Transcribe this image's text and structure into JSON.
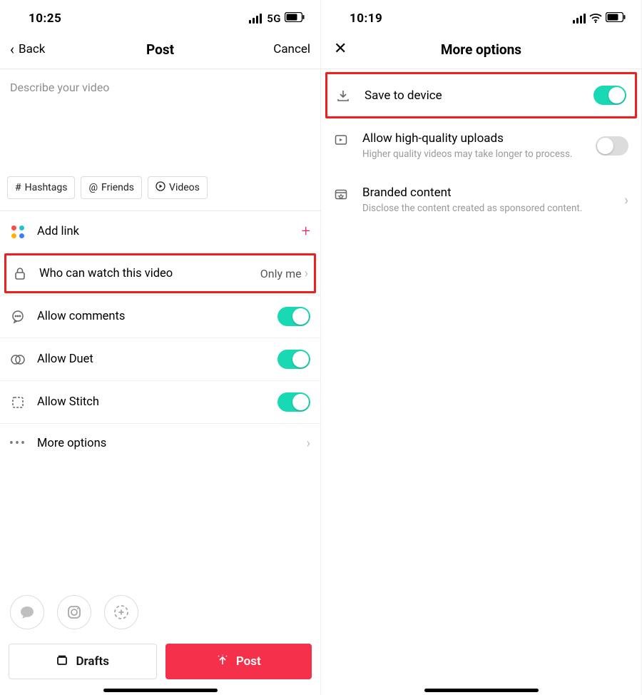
{
  "left": {
    "status": {
      "time": "10:25",
      "network": "5G"
    },
    "nav": {
      "back": "Back",
      "title": "Post",
      "cancel": "Cancel"
    },
    "describe_placeholder": "Describe your video",
    "chips": {
      "hashtags": "Hashtags",
      "friends": "Friends",
      "videos": "Videos"
    },
    "rows": {
      "add_link": "Add link",
      "privacy_label": "Who can watch this video",
      "privacy_value": "Only me",
      "allow_comments": "Allow comments",
      "allow_duet": "Allow Duet",
      "allow_stitch": "Allow Stitch",
      "more_options": "More options"
    },
    "buttons": {
      "drafts": "Drafts",
      "post": "Post"
    }
  },
  "right": {
    "status": {
      "time": "10:19"
    },
    "nav": {
      "title": "More options"
    },
    "options": {
      "save_label": "Save to device",
      "hq_label": "Allow high-quality uploads",
      "hq_sub": "Higher quality videos may take longer to process.",
      "branded_label": "Branded content",
      "branded_sub": "Disclose the content created as sponsored content."
    }
  }
}
